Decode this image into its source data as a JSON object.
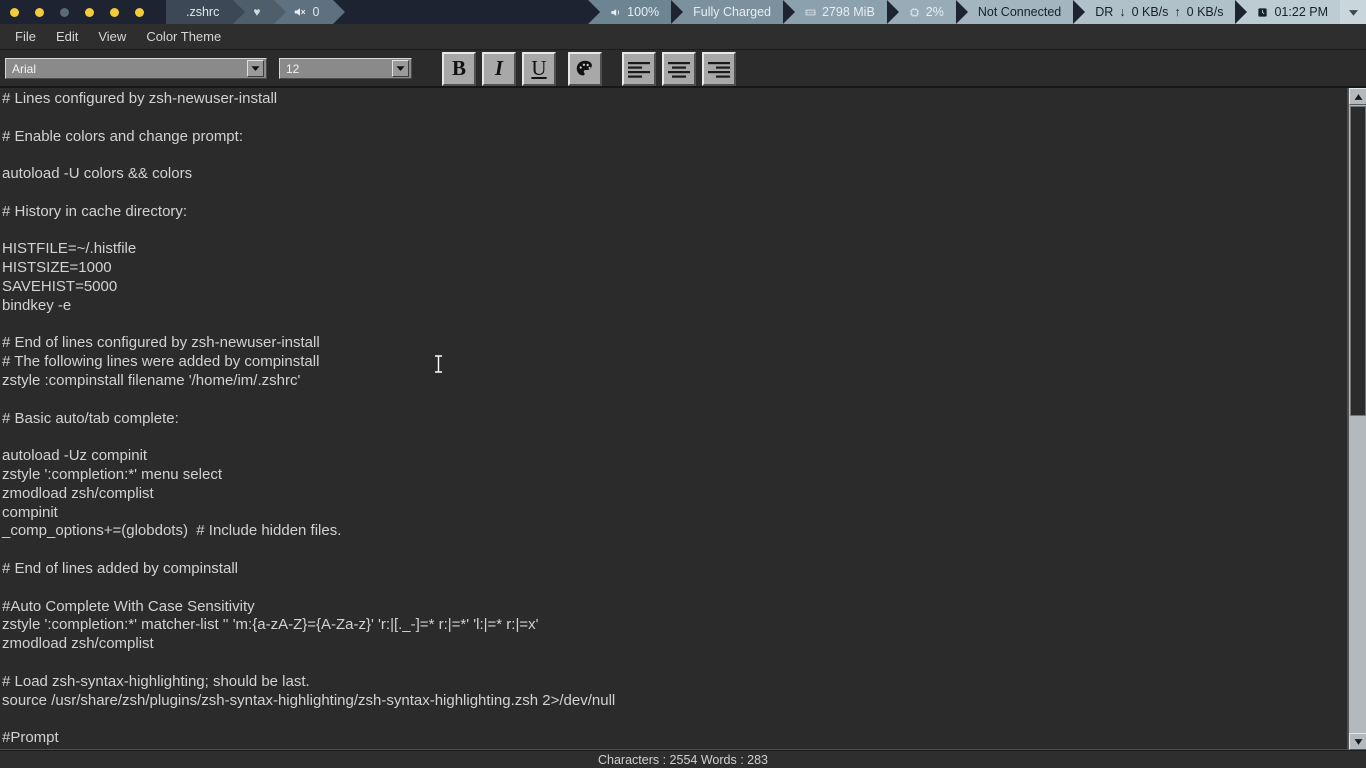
{
  "panel": {
    "workspaces": [
      {
        "name": "workspace-1",
        "active": true
      },
      {
        "name": "workspace-2",
        "active": true
      },
      {
        "name": "workspace-3",
        "active": false
      },
      {
        "name": "workspace-4",
        "active": true
      },
      {
        "name": "workspace-5",
        "active": true
      },
      {
        "name": "workspace-6",
        "active": true
      }
    ],
    "window_title": ".zshrc",
    "heart_icon": "♥",
    "volume_icon": "🔇",
    "volume_value": "0",
    "right": {
      "brightness_icon": "◂",
      "brightness": "100%",
      "battery": "Fully Charged",
      "memory_icon": "▒",
      "memory": "2798 MiB",
      "cpu_icon": "░",
      "cpu": "2%",
      "network": "Not Connected",
      "net_prefix": "DR",
      "download_icon": "↓",
      "download": "0 KB/s",
      "upload_icon": "↑",
      "upload": "0 KB/s",
      "clock_icon": "◴",
      "clock": "01:22 PM",
      "tray_chevron": "chevron-down-icon"
    }
  },
  "menu": {
    "items": [
      "File",
      "Edit",
      "View",
      "Color Theme"
    ]
  },
  "toolbar": {
    "font_family": "Arial",
    "font_size": "12",
    "bold_label": "B",
    "italic_label": "I",
    "underline_label": "U",
    "color_label": "palette-icon",
    "align_left_label": "align-left-icon",
    "align_center_label": "align-center-icon",
    "align_right_label": "align-right-icon",
    "dropdown_glyph": "▼"
  },
  "editor": {
    "lines": [
      "# Lines configured by zsh-newuser-install",
      "",
      "# Enable colors and change prompt:",
      "",
      "autoload -U colors && colors",
      "",
      "# History in cache directory:",
      "",
      "HISTFILE=~/.histfile",
      "HISTSIZE=1000",
      "SAVEHIST=5000",
      "bindkey -e",
      "",
      "# End of lines configured by zsh-newuser-install",
      "# The following lines were added by compinstall",
      "zstyle :compinstall filename '/home/im/.zshrc'",
      "",
      "# Basic auto/tab complete:",
      "",
      "autoload -Uz compinit",
      "zstyle ':completion:*' menu select",
      "zmodload zsh/complist",
      "compinit",
      "_comp_options+=(globdots)  # Include hidden files.",
      "",
      "# End of lines added by compinstall",
      "",
      "#Auto Complete With Case Sensitivity",
      "zstyle ':completion:*' matcher-list '' 'm:{a-zA-Z}={A-Za-z}' 'r:|[._-]=* r:|=*' 'l:|=* r:|=x'",
      "zmodload zsh/complist",
      "",
      "# Load zsh-syntax-highlighting; should be last.",
      "source /usr/share/zsh/plugins/zsh-syntax-highlighting/zsh-syntax-highlighting.zsh 2>/dev/null",
      "",
      "#Prompt"
    ]
  },
  "scrollbar": {
    "up_arrow": "▲",
    "down_arrow": "▼"
  },
  "status": {
    "text": "Characters : 2554 Words : 283"
  },
  "colors": {
    "panel_bg": "#1d2330",
    "workspace_active": "#f3cc3a",
    "workspace_inactive": "#5b6a73",
    "editor_bg": "#2b2b2b",
    "editor_text": "#d2d2d2",
    "toolbar_bg": "#2b2b2b",
    "button_face": "#a8a8a8"
  }
}
